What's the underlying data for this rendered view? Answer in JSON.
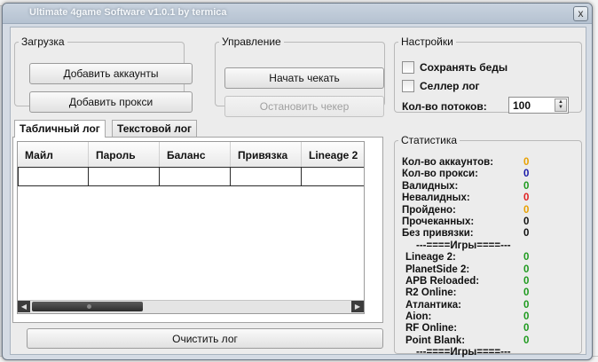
{
  "window": {
    "title": "Ultimate 4game Software v1.0.1 by termica",
    "close_glyph": "x"
  },
  "load": {
    "legend": "Загрузка",
    "add_accounts": "Добавить аккаунты",
    "add_proxy": "Добавить прокси"
  },
  "control": {
    "legend": "Управление",
    "start": "Начать чекать",
    "stop": "Остановить чекер",
    "stop_enabled": false
  },
  "settings": {
    "legend": "Настройки",
    "save_bad": {
      "label": "Сохранять беды",
      "checked": false
    },
    "seller_log": {
      "label": "Селлер лог",
      "checked": false
    },
    "threads_label": "Кол-во потоков:",
    "threads_value": "100"
  },
  "log": {
    "tabs": [
      {
        "label": "Табличный лог",
        "active": true
      },
      {
        "label": "Текстовой лог",
        "active": false
      }
    ],
    "columns": [
      "Майл",
      "Пароль",
      "Баланс",
      "Привязка",
      "Lineage 2"
    ],
    "clear": "Очистить лог"
  },
  "stats": {
    "legend": "Статистика",
    "rows": [
      {
        "label": "Кол-во аккаунтов:",
        "value": "0",
        "color": "#e8a000"
      },
      {
        "label": "Кол-во прокси:",
        "value": "0",
        "color": "#1a1aa8"
      },
      {
        "label": "Валидных:",
        "value": "0",
        "color": "#1e9a1e"
      },
      {
        "label": "Невалидных:",
        "value": "0",
        "color": "#e02020"
      },
      {
        "label": "Пройдено:",
        "value": "0",
        "color": "#e8a000"
      },
      {
        "label": "Прочеканных:",
        "value": "0",
        "color": "#111111"
      },
      {
        "label": "Без привязки:",
        "value": "0",
        "color": "#111111"
      }
    ],
    "games_separator_top": "---====Игры====---",
    "games": [
      {
        "label": "Lineage 2:",
        "value": "0",
        "color": "#1e9a1e"
      },
      {
        "label": "PlanetSide 2:",
        "value": "0",
        "color": "#1e9a1e"
      },
      {
        "label": "APB Reloaded:",
        "value": "0",
        "color": "#1e9a1e"
      },
      {
        "label": "R2 Online:",
        "value": "0",
        "color": "#1e9a1e"
      },
      {
        "label": "Атлантика:",
        "value": "0",
        "color": "#1e9a1e"
      },
      {
        "label": "Aion:",
        "value": "0",
        "color": "#1e9a1e"
      },
      {
        "label": "RF Online:",
        "value": "0",
        "color": "#1e9a1e"
      },
      {
        "label": "Point Blank:",
        "value": "0",
        "color": "#1e9a1e"
      }
    ],
    "games_separator_bottom": "---====Игры====---"
  }
}
